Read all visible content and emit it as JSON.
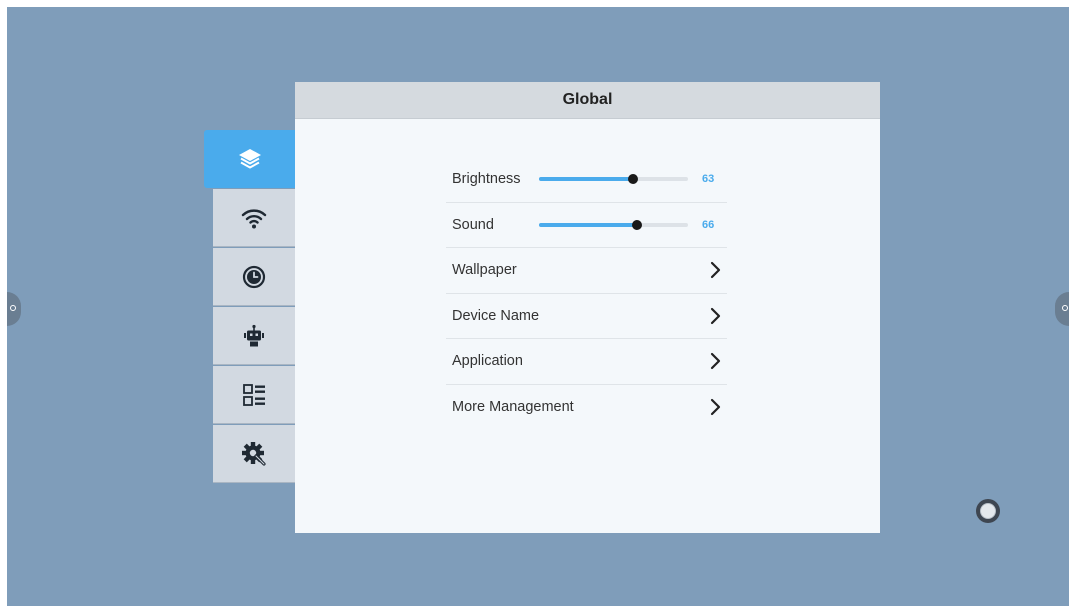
{
  "panel": {
    "title": "Global"
  },
  "sidebar": {
    "tabs": [
      {
        "icon": "layers-icon",
        "active": true
      },
      {
        "icon": "wifi-icon",
        "active": false
      },
      {
        "icon": "clock-icon",
        "active": false
      },
      {
        "icon": "robot-icon",
        "active": false
      },
      {
        "icon": "app-list-icon",
        "active": false
      },
      {
        "icon": "gear-wrench-icon",
        "active": false
      }
    ]
  },
  "settings": {
    "brightness": {
      "label": "Brightness",
      "value": "63",
      "level": 63
    },
    "sound": {
      "label": "Sound",
      "value": "66",
      "level": 66
    },
    "wallpaper": {
      "label": "Wallpaper"
    },
    "device_name": {
      "label": "Device Name"
    },
    "application": {
      "label": "Application"
    },
    "more_management": {
      "label": "More Management"
    }
  },
  "colors": {
    "accent": "#4aabec",
    "desktop": "#7f9dba",
    "panel_header": "#d5dadf"
  }
}
